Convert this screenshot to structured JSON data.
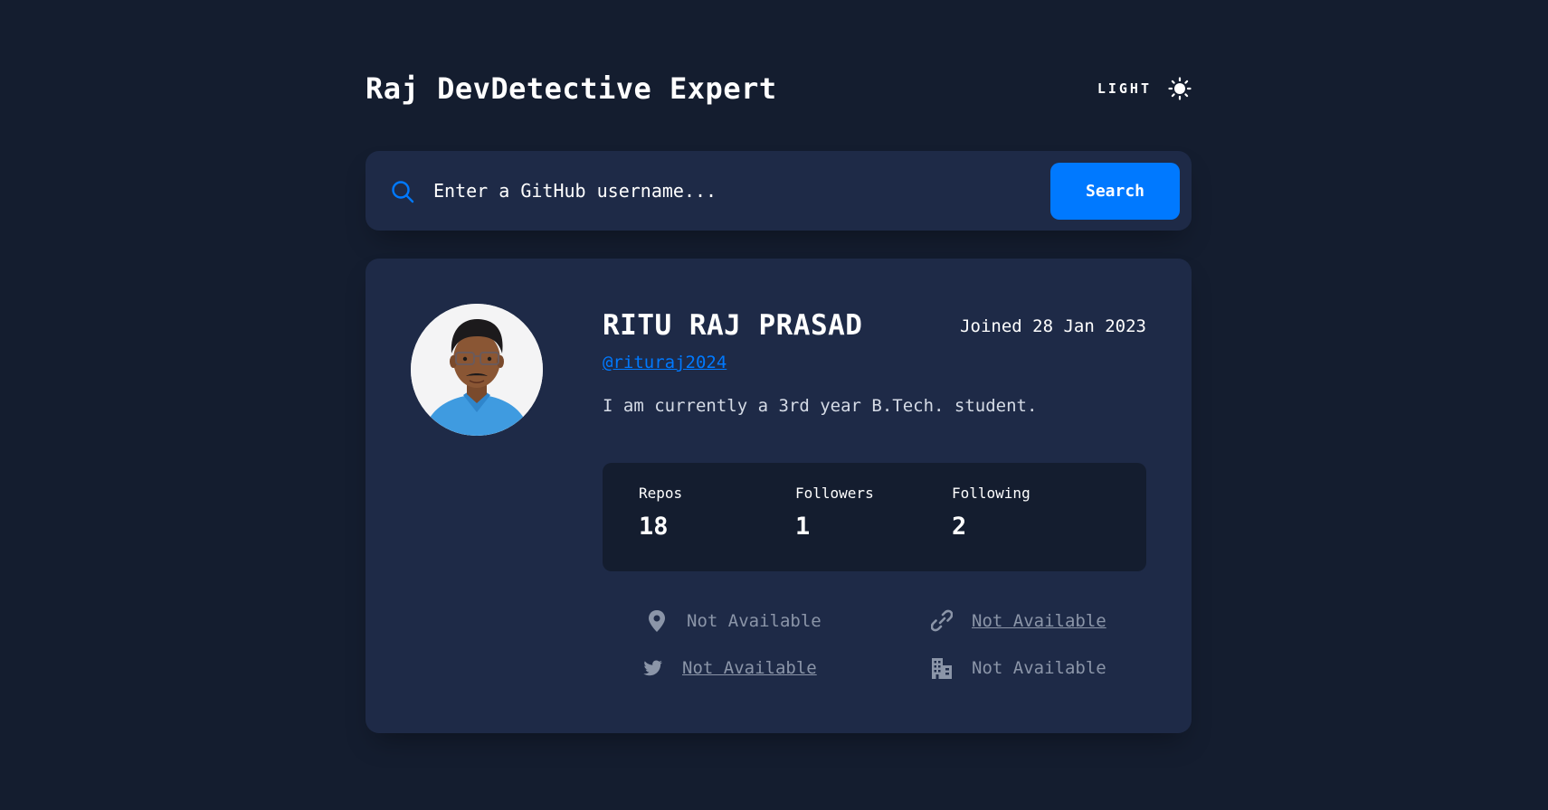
{
  "header": {
    "title": "Raj DevDetective Expert",
    "theme_label": "LIGHT",
    "theme_icon": "sun-icon"
  },
  "search": {
    "placeholder": "Enter a GitHub username...",
    "button_label": "Search",
    "icon": "search-icon"
  },
  "profile": {
    "name": "RITU RAJ PRASAD",
    "joined": "Joined 28 Jan 2023",
    "login": "@rituraj2024",
    "bio": "I am currently a 3rd year B.Tech. student.",
    "stats": [
      {
        "label": "Repos",
        "value": "18"
      },
      {
        "label": "Followers",
        "value": "1"
      },
      {
        "label": "Following",
        "value": "2"
      }
    ],
    "links": {
      "location": {
        "icon": "location-pin-icon",
        "text": "Not Available"
      },
      "website": {
        "icon": "link-icon",
        "text": "Not Available"
      },
      "twitter": {
        "icon": "twitter-icon",
        "text": "Not Available"
      },
      "company": {
        "icon": "building-icon",
        "text": "Not Available"
      }
    }
  },
  "colors": {
    "background": "#141d2f",
    "card": "#1e2a47",
    "accent": "#0079ff",
    "muted": "#8b95a8"
  }
}
